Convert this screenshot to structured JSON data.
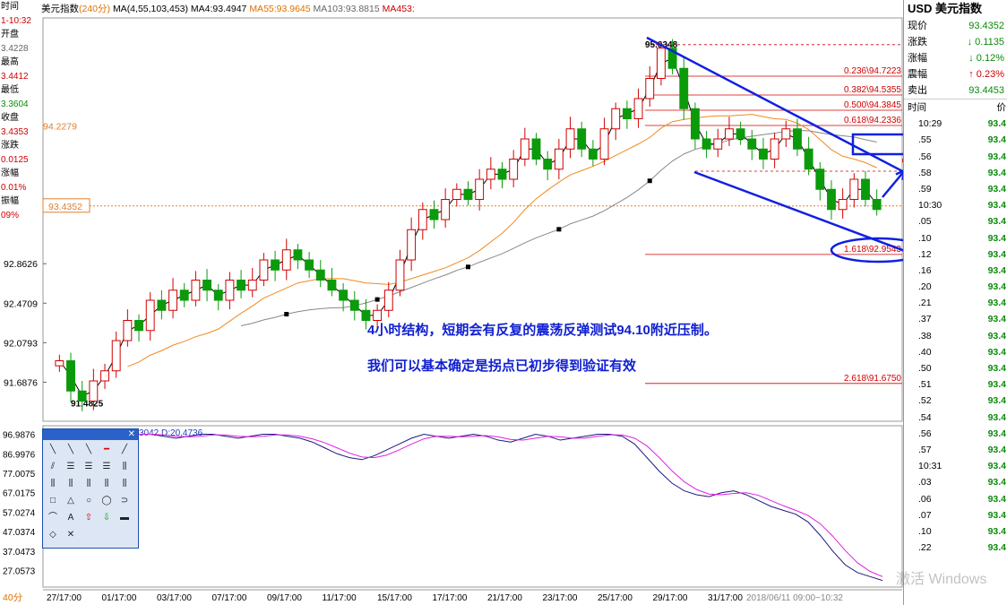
{
  "header": {
    "title": "美元指数",
    "period": "(240分)",
    "ma_label": "MA(4,55,103,453)",
    "ma4": "MA4:93.4947",
    "ma55": "MA55:93.9645",
    "ma103": "MA103:93.8815",
    "ma453": "MA453:"
  },
  "left_panel": {
    "items": [
      "时间",
      "1-10:32",
      "开盘",
      "3.4228",
      "最高",
      "3.4412",
      "最低",
      "3.3604",
      "收盘",
      "3.4353",
      "涨跌",
      "0.0125",
      "涨幅",
      "0.01%",
      "振幅",
      "09%"
    ]
  },
  "price_labels": {
    "current": "93.4352",
    "ma_tag": "94.2279",
    "high_mark": "95.0348",
    "low_mark": "91.4825",
    "y_ticks": [
      "92.8626",
      "92.4709",
      "92.0793",
      "91.6876"
    ]
  },
  "fib_levels": [
    {
      "label": "0.236\\94.7223",
      "color": "#d00000"
    },
    {
      "label": "0.382\\94.5355",
      "color": "#d00000"
    },
    {
      "label": "0.500\\94.3845",
      "color": "#d00000"
    },
    {
      "label": "0.618\\94.2336",
      "color": "#d00000"
    },
    {
      "label": "1.618\\92.9543",
      "color": "#d00000"
    },
    {
      "label": "2.618\\91.6750",
      "color": "#d00000"
    }
  ],
  "annotations": {
    "line1": "4小时结构，短期会有反复的震荡反弹测试94.10附近压制。",
    "line2": "我们可以基本确定是拐点已初步得到验证有效"
  },
  "indicator": {
    "header": "3042  D:20.4736",
    "y_ticks": [
      "96.9876",
      "86.9976",
      "77.0075",
      "67.0175",
      "57.0274",
      "47.0374",
      "37.0473",
      "27.0573"
    ]
  },
  "x_axis": {
    "period_label": "40分",
    "ticks": [
      "27/17:00",
      "01/17:00",
      "03/17:00",
      "07/17:00",
      "09/17:00",
      "11/17:00",
      "15/17:00",
      "17/17:00",
      "21/17:00",
      "23/17:00",
      "25/17:00",
      "29/17:00",
      "31/17:00"
    ],
    "range_label": "2018/06/11 09:00~10:32"
  },
  "right_panel": {
    "title": "USD 美元指数",
    "quotes": [
      {
        "k": "现价",
        "v": "93.4352",
        "color": "#0a8a0a"
      },
      {
        "k": "涨跌",
        "v": "↓ 0.1135",
        "color": "#0a8a0a"
      },
      {
        "k": "涨幅",
        "v": "↓ 0.12%",
        "color": "#0a8a0a"
      },
      {
        "k": "震幅",
        "v": "↑ 0.23%",
        "color": "#d00000"
      },
      {
        "k": "卖出",
        "v": "93.4453",
        "color": "#0a8a0a"
      }
    ],
    "col_time": "时间",
    "col_price": "价",
    "ticks": [
      {
        "t": "10:29",
        "p": "93.4"
      },
      {
        "t": ".55",
        "p": "93.4"
      },
      {
        "t": ".56",
        "p": "93.4"
      },
      {
        "t": ".58",
        "p": "93.4"
      },
      {
        "t": ".59",
        "p": "93.4"
      },
      {
        "t": "10:30",
        "p": "93.4"
      },
      {
        "t": ".05",
        "p": "93.4"
      },
      {
        "t": ".10",
        "p": "93.4"
      },
      {
        "t": ".12",
        "p": "93.4"
      },
      {
        "t": ".16",
        "p": "93.4"
      },
      {
        "t": ".20",
        "p": "93.4"
      },
      {
        "t": ".21",
        "p": "93.4"
      },
      {
        "t": ".37",
        "p": "93.4"
      },
      {
        "t": ".38",
        "p": "93.4"
      },
      {
        "t": ".40",
        "p": "93.4"
      },
      {
        "t": ".50",
        "p": "93.4"
      },
      {
        "t": ".51",
        "p": "93.4"
      },
      {
        "t": ".52",
        "p": "93.4"
      },
      {
        "t": ".54",
        "p": "93.4"
      },
      {
        "t": ".56",
        "p": "93.4"
      },
      {
        "t": ".57",
        "p": "93.4"
      },
      {
        "t": "10:31",
        "p": "93.4"
      },
      {
        "t": ".03",
        "p": "93.4"
      },
      {
        "t": ".06",
        "p": "93.4"
      },
      {
        "t": ".07",
        "p": "93.4"
      },
      {
        "t": ".10",
        "p": "93.4"
      },
      {
        "t": ".22",
        "p": "93.4"
      }
    ]
  },
  "watermark": "激活 Windows",
  "chart_data": {
    "type": "candlestick",
    "title": "美元指数 (240分)",
    "ylim": [
      91.3,
      95.3
    ],
    "candles_close": [
      91.9,
      91.6,
      91.5,
      91.7,
      91.8,
      92.1,
      92.3,
      92.2,
      92.5,
      92.4,
      92.6,
      92.5,
      92.7,
      92.6,
      92.5,
      92.7,
      92.6,
      92.7,
      92.9,
      92.8,
      93.0,
      92.9,
      92.8,
      92.7,
      92.6,
      92.5,
      92.4,
      92.3,
      92.4,
      92.6,
      92.9,
      93.2,
      93.4,
      93.3,
      93.5,
      93.6,
      93.5,
      93.7,
      93.8,
      93.7,
      93.9,
      94.1,
      93.9,
      93.8,
      94.0,
      94.2,
      94.0,
      93.9,
      94.2,
      94.4,
      94.3,
      94.5,
      94.7,
      95.0,
      94.8,
      94.4,
      94.1,
      94.0,
      94.1,
      94.2,
      94.1,
      94.0,
      93.9,
      94.1,
      94.2,
      94.0,
      93.8,
      93.6,
      93.4,
      93.5,
      93.7,
      93.5,
      93.4
    ],
    "high": 95.0348,
    "low": 91.4825,
    "current": 93.4352,
    "fibonacci": [
      {
        "ratio": 0.236,
        "price": 94.7223
      },
      {
        "ratio": 0.382,
        "price": 94.5355
      },
      {
        "ratio": 0.5,
        "price": 94.3845
      },
      {
        "ratio": 0.618,
        "price": 94.2336
      },
      {
        "ratio": 1.618,
        "price": 92.9543
      },
      {
        "ratio": 2.618,
        "price": 91.675
      }
    ],
    "indicator_ylim": [
      20,
      100
    ],
    "indicator_k": [
      97,
      97,
      96,
      95,
      96,
      97,
      97,
      96,
      95,
      96,
      97,
      97,
      96,
      95,
      93,
      90,
      87,
      85,
      84,
      86,
      89,
      92,
      95,
      97,
      96,
      95,
      96,
      97,
      96,
      94,
      93,
      95,
      97,
      96,
      94,
      95,
      96,
      97,
      97,
      96,
      92,
      85,
      78,
      72,
      68,
      66,
      65,
      67,
      68,
      66,
      63,
      60,
      58,
      56,
      52,
      45,
      37,
      30,
      26,
      24,
      22
    ]
  }
}
